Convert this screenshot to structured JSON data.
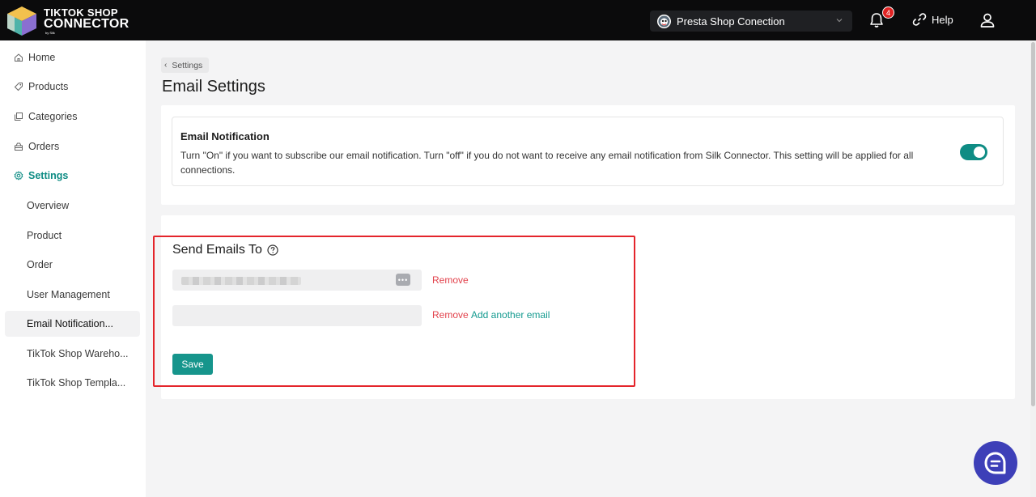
{
  "app": {
    "logo_line1": "TIKTOK SHOP",
    "logo_line2": "CONNECTOR",
    "logo_byline": "by Silk"
  },
  "header": {
    "shop_selector": "Presta Shop Conection",
    "notification_count": "4",
    "help_label": "Help"
  },
  "sidebar": {
    "items": [
      {
        "label": "Home",
        "icon": "home-icon"
      },
      {
        "label": "Products",
        "icon": "tag-icon"
      },
      {
        "label": "Categories",
        "icon": "copy-icon"
      },
      {
        "label": "Orders",
        "icon": "box-icon"
      },
      {
        "label": "Settings",
        "icon": "gear-icon"
      }
    ],
    "sub_items": [
      {
        "label": "Overview"
      },
      {
        "label": "Product"
      },
      {
        "label": "Order"
      },
      {
        "label": "User Management"
      },
      {
        "label": "Email Notification..."
      },
      {
        "label": "TikTok Shop Wareho..."
      },
      {
        "label": "TikTok Shop Templa..."
      }
    ]
  },
  "main": {
    "breadcrumb": "Settings",
    "title": "Email Settings",
    "notification": {
      "title": "Email Notification",
      "description": "Turn \"On\" if you want to subscribe our email notification. Turn \"off\" if you do not want to receive any email notification from Silk Connector. This setting will be applied for all connections.",
      "enabled": true
    },
    "send_to": {
      "title": "Send Emails To",
      "remove_label": "Remove",
      "add_label": "Add another email",
      "save_label": "Save",
      "second_email_value": ""
    }
  },
  "colors": {
    "accent": "#0e8c84",
    "danger": "#e2414b",
    "topbar": "#0b0b0c",
    "chat": "#3d3fb8",
    "highlight": "#e4252b"
  }
}
